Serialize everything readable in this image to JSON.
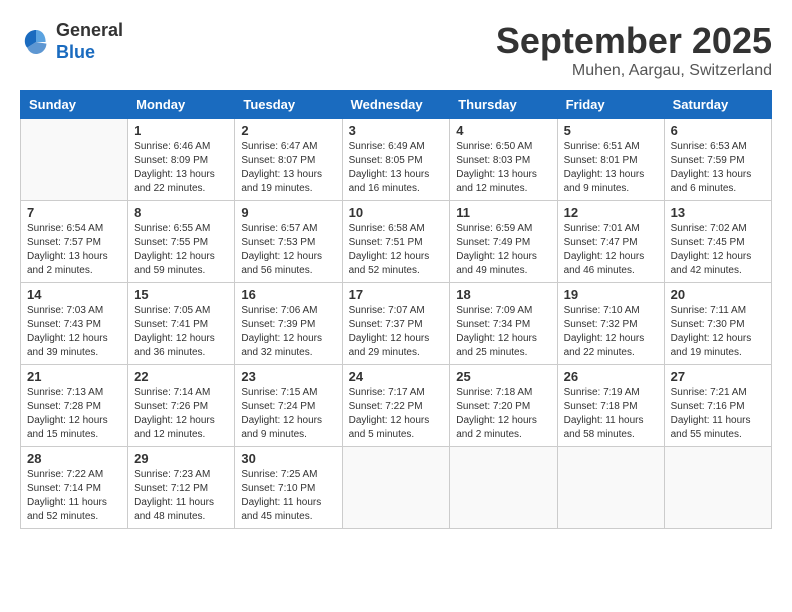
{
  "header": {
    "logo_general": "General",
    "logo_blue": "Blue",
    "month_year": "September 2025",
    "location": "Muhen, Aargau, Switzerland"
  },
  "weekdays": [
    "Sunday",
    "Monday",
    "Tuesday",
    "Wednesday",
    "Thursday",
    "Friday",
    "Saturday"
  ],
  "weeks": [
    [
      {
        "day": "",
        "info": ""
      },
      {
        "day": "1",
        "info": "Sunrise: 6:46 AM\nSunset: 8:09 PM\nDaylight: 13 hours\nand 22 minutes."
      },
      {
        "day": "2",
        "info": "Sunrise: 6:47 AM\nSunset: 8:07 PM\nDaylight: 13 hours\nand 19 minutes."
      },
      {
        "day": "3",
        "info": "Sunrise: 6:49 AM\nSunset: 8:05 PM\nDaylight: 13 hours\nand 16 minutes."
      },
      {
        "day": "4",
        "info": "Sunrise: 6:50 AM\nSunset: 8:03 PM\nDaylight: 13 hours\nand 12 minutes."
      },
      {
        "day": "5",
        "info": "Sunrise: 6:51 AM\nSunset: 8:01 PM\nDaylight: 13 hours\nand 9 minutes."
      },
      {
        "day": "6",
        "info": "Sunrise: 6:53 AM\nSunset: 7:59 PM\nDaylight: 13 hours\nand 6 minutes."
      }
    ],
    [
      {
        "day": "7",
        "info": "Sunrise: 6:54 AM\nSunset: 7:57 PM\nDaylight: 13 hours\nand 2 minutes."
      },
      {
        "day": "8",
        "info": "Sunrise: 6:55 AM\nSunset: 7:55 PM\nDaylight: 12 hours\nand 59 minutes."
      },
      {
        "day": "9",
        "info": "Sunrise: 6:57 AM\nSunset: 7:53 PM\nDaylight: 12 hours\nand 56 minutes."
      },
      {
        "day": "10",
        "info": "Sunrise: 6:58 AM\nSunset: 7:51 PM\nDaylight: 12 hours\nand 52 minutes."
      },
      {
        "day": "11",
        "info": "Sunrise: 6:59 AM\nSunset: 7:49 PM\nDaylight: 12 hours\nand 49 minutes."
      },
      {
        "day": "12",
        "info": "Sunrise: 7:01 AM\nSunset: 7:47 PM\nDaylight: 12 hours\nand 46 minutes."
      },
      {
        "day": "13",
        "info": "Sunrise: 7:02 AM\nSunset: 7:45 PM\nDaylight: 12 hours\nand 42 minutes."
      }
    ],
    [
      {
        "day": "14",
        "info": "Sunrise: 7:03 AM\nSunset: 7:43 PM\nDaylight: 12 hours\nand 39 minutes."
      },
      {
        "day": "15",
        "info": "Sunrise: 7:05 AM\nSunset: 7:41 PM\nDaylight: 12 hours\nand 36 minutes."
      },
      {
        "day": "16",
        "info": "Sunrise: 7:06 AM\nSunset: 7:39 PM\nDaylight: 12 hours\nand 32 minutes."
      },
      {
        "day": "17",
        "info": "Sunrise: 7:07 AM\nSunset: 7:37 PM\nDaylight: 12 hours\nand 29 minutes."
      },
      {
        "day": "18",
        "info": "Sunrise: 7:09 AM\nSunset: 7:34 PM\nDaylight: 12 hours\nand 25 minutes."
      },
      {
        "day": "19",
        "info": "Sunrise: 7:10 AM\nSunset: 7:32 PM\nDaylight: 12 hours\nand 22 minutes."
      },
      {
        "day": "20",
        "info": "Sunrise: 7:11 AM\nSunset: 7:30 PM\nDaylight: 12 hours\nand 19 minutes."
      }
    ],
    [
      {
        "day": "21",
        "info": "Sunrise: 7:13 AM\nSunset: 7:28 PM\nDaylight: 12 hours\nand 15 minutes."
      },
      {
        "day": "22",
        "info": "Sunrise: 7:14 AM\nSunset: 7:26 PM\nDaylight: 12 hours\nand 12 minutes."
      },
      {
        "day": "23",
        "info": "Sunrise: 7:15 AM\nSunset: 7:24 PM\nDaylight: 12 hours\nand 9 minutes."
      },
      {
        "day": "24",
        "info": "Sunrise: 7:17 AM\nSunset: 7:22 PM\nDaylight: 12 hours\nand 5 minutes."
      },
      {
        "day": "25",
        "info": "Sunrise: 7:18 AM\nSunset: 7:20 PM\nDaylight: 12 hours\nand 2 minutes."
      },
      {
        "day": "26",
        "info": "Sunrise: 7:19 AM\nSunset: 7:18 PM\nDaylight: 11 hours\nand 58 minutes."
      },
      {
        "day": "27",
        "info": "Sunrise: 7:21 AM\nSunset: 7:16 PM\nDaylight: 11 hours\nand 55 minutes."
      }
    ],
    [
      {
        "day": "28",
        "info": "Sunrise: 7:22 AM\nSunset: 7:14 PM\nDaylight: 11 hours\nand 52 minutes."
      },
      {
        "day": "29",
        "info": "Sunrise: 7:23 AM\nSunset: 7:12 PM\nDaylight: 11 hours\nand 48 minutes."
      },
      {
        "day": "30",
        "info": "Sunrise: 7:25 AM\nSunset: 7:10 PM\nDaylight: 11 hours\nand 45 minutes."
      },
      {
        "day": "",
        "info": ""
      },
      {
        "day": "",
        "info": ""
      },
      {
        "day": "",
        "info": ""
      },
      {
        "day": "",
        "info": ""
      }
    ]
  ]
}
